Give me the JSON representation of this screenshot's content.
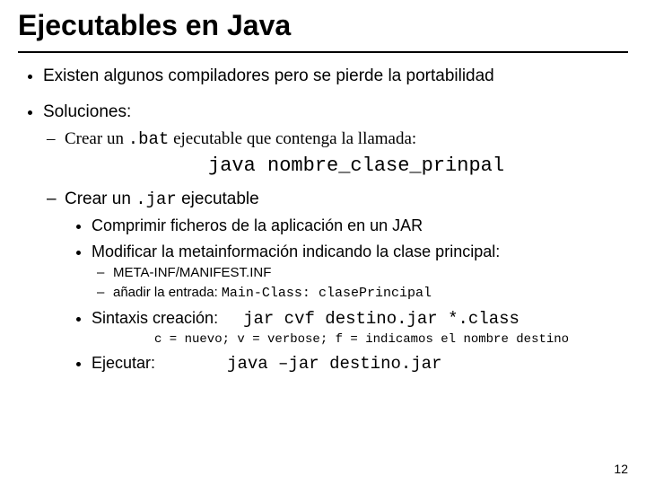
{
  "title": "Ejecutables en Java",
  "b1": "Existen algunos compiladores pero se pierde la portabilidad",
  "b2": "Soluciones:",
  "d1_pre": "Crear un ",
  "d1_code": ".bat",
  "d1_post": " ejecutable que contenga la llamada:",
  "cmd1": "java nombre_clase_prinpal",
  "d2_pre": "Crear un ",
  "d2_code": ".jar",
  "d2_post": " ejecutable",
  "s1": "Comprimir ficheros de la aplicación en un JAR",
  "s2": "Modificar la metainformación indicando la clase principal:",
  "sd1": "META-INF/MANIFEST.INF",
  "sd2_pre": "añadir la entrada: ",
  "sd2_code": "Main-Class: clasePrincipal",
  "s3_label": "Sintaxis creación:",
  "s3_code": "jar cvf destino.jar *.class",
  "note": "c = nuevo; v = verbose; f = indicamos el nombre destino",
  "s4_label": "Ejecutar:",
  "s4_code": "java –jar destino.jar",
  "page": "12"
}
